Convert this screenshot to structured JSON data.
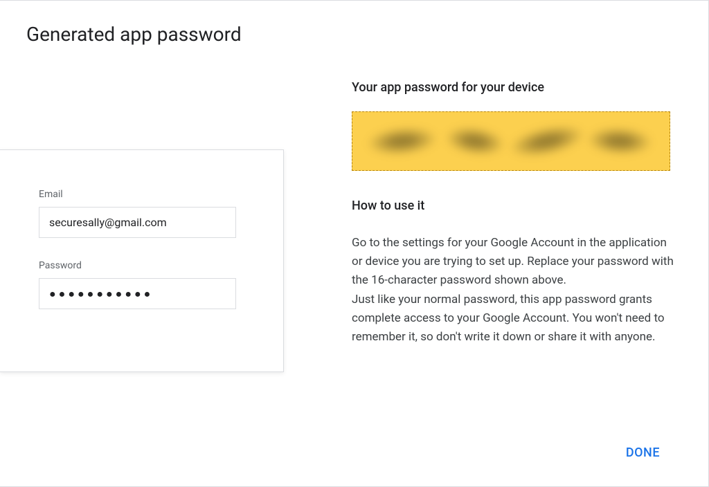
{
  "title": "Generated app password",
  "login": {
    "email_label": "Email",
    "email_value": "securesally@gmail.com",
    "password_label": "Password",
    "password_value": "●●●●●●●●●●●"
  },
  "right": {
    "heading": "Your app password for your device",
    "how_to_heading": "How to use it",
    "instructions": "Go to the settings for your Google Account in the application or device you are trying to set up. Replace your password with the 16-character password shown above.\nJust like your normal password, this app password grants complete access to your Google Account. You won't need to remember it, so don't write it down or share it with anyone."
  },
  "buttons": {
    "done": "DONE"
  },
  "colors": {
    "accent": "#1a73e8",
    "highlight": "#fcd04f"
  }
}
